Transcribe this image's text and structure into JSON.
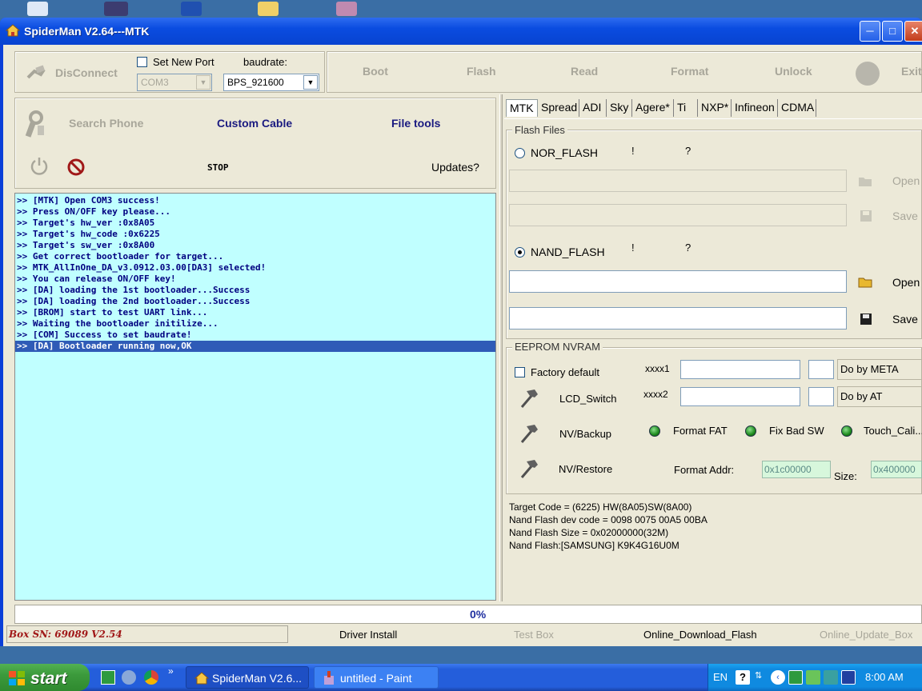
{
  "window": {
    "title": "SpiderMan V2.64---MTK"
  },
  "toolbar": {
    "disconnect_label": "DisConnect",
    "set_new_port_label": "Set New Port",
    "set_new_port_checked": false,
    "port_value": "COM3",
    "baudrate_label": "baudrate:",
    "baudrate_value": "BPS_921600",
    "boot_label": "Boot",
    "flash_label": "Flash",
    "read_label": "Read",
    "format_label": "Format",
    "unlock_label": "Unlock",
    "exit_label": "Exit"
  },
  "tools": {
    "search_phone_label": "Search Phone",
    "custom_cable_label": "Custom Cable",
    "file_tools_label": "File tools",
    "stop_label": "STOP",
    "updates_label": "Updates?"
  },
  "log": {
    "lines": [
      ">> [MTK] Open COM3 success!",
      ">> Press ON/OFF key please...",
      ">> Target's hw_ver :0x8A05",
      ">> Target's hw_code :0x6225",
      ">> Target's sw_ver :0x8A00",
      ">> Get correct bootloader for target...",
      ">> MTK_AllInOne_DA_v3.0912.03.00[DA3] selected!",
      ">> You can release ON/OFF key!",
      ">> [DA] loading the 1st bootloader...Success",
      ">> [DA] loading the 2nd bootloader...Success",
      ">> [BROM] start to test UART link...",
      ">> Waiting the bootloader initilize...",
      ">> [COM] Success to set baudrate!",
      ">> [DA] Bootloader running now,OK"
    ],
    "selected_index": 13
  },
  "tabs": [
    "MTK",
    "Spread",
    "ADI",
    "Sky",
    "Agere*",
    "Ti",
    "NXP*",
    "Infineon",
    "CDMA"
  ],
  "active_tab": "MTK",
  "flash_files": {
    "title": "Flash Files",
    "nor_label": "NOR_FLASH",
    "nor_selected": false,
    "nor_excl": "!",
    "nor_q": "?",
    "nor_open": "Open",
    "nor_save": "Save",
    "nand_label": "NAND_FLASH",
    "nand_selected": true,
    "nand_excl": "!",
    "nand_q": "?",
    "nand_open": "Open",
    "nand_save": "Save"
  },
  "eeprom": {
    "title": "EEPROM NVRAM",
    "factory_default_label": "Factory default",
    "xxxx1_label": "xxxx1",
    "xxxx2_label": "xxxx2",
    "do_by_meta": "Do by META",
    "do_by_at": "Do by AT",
    "lcd_switch": "LCD_Switch",
    "nv_backup": "NV/Backup",
    "nv_restore": "NV/Restore",
    "format_fat": "Format FAT",
    "fix_bad_sw": "Fix Bad SW",
    "touch_cali": "Touch_Cali...",
    "format_addr_label": "Format Addr:",
    "format_addr_value": "0x1c00000",
    "size_label": "Size:",
    "size_value": "0x400000"
  },
  "info": {
    "lines": [
      "Target Code = (6225) HW(8A05)SW(8A00)",
      "Nand Flash dev code = 0098 0075 00A5 00BA",
      "Nand Flash Size = 0x02000000(32M)",
      "Nand Flash:[SAMSUNG] K9K4G16U0M"
    ]
  },
  "progress": {
    "text": "0%",
    "fraction": 0
  },
  "status": {
    "box_sn": "Box SN: 69089   V2.54",
    "driver_install": "Driver Install",
    "test_box": "Test Box",
    "online_download": "Online_Download_Flash",
    "online_update": "Online_Update_Box"
  },
  "taskbar": {
    "start_label": "start",
    "task1": "SpiderMan V2.6...",
    "task2": "untitled - Paint",
    "lang": "EN",
    "clock": "8:00 AM"
  },
  "colors": {
    "log_bg": "#c0ffff",
    "log_text": "#000080",
    "selection": "#2f5bb7",
    "taskbar": "#245edb",
    "start_green": "#3c9a3c"
  }
}
